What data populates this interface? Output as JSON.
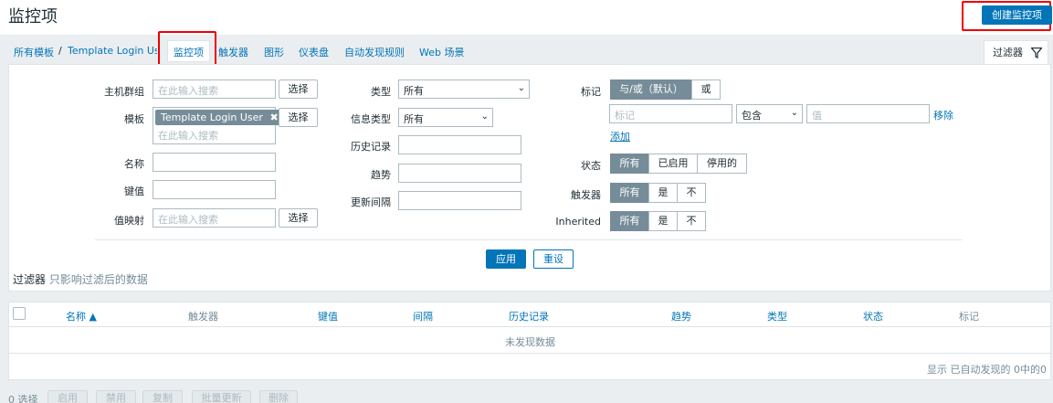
{
  "header": {
    "title": "监控项",
    "create_button": "创建监控项"
  },
  "breadcrumb": {
    "all_templates": "所有模板",
    "separator": "/",
    "template": "Template Login User"
  },
  "tabs": {
    "items": "监控项",
    "triggers": "触发器",
    "graphs": "图形",
    "dashboards": "仪表盘",
    "discovery": "自动发现规则",
    "web": "Web 场景"
  },
  "filter_tab": {
    "label": "过滤器",
    "icon": "filter-icon"
  },
  "filter": {
    "host_groups_label": "主机群组",
    "host_groups_placeholder": "在此输入搜索",
    "templates_label": "模板",
    "template_chip": "Template Login User",
    "templates_placeholder": "在此输入搜索",
    "name_label": "名称",
    "key_label": "键值",
    "valuemap_label": "值映射",
    "valuemap_placeholder": "在此输入搜索",
    "select_button": "选择",
    "type_label": "类型",
    "type_value": "所有",
    "info_type_label": "信息类型",
    "info_type_value": "所有",
    "history_label": "历史记录",
    "trends_label": "趋势",
    "update_interval_label": "更新间隔",
    "tags_label": "标记",
    "tags_andor": "与/或（默认）",
    "tags_or": "或",
    "tag_placeholder": "标记",
    "tag_operator": "包含",
    "tag_value_placeholder": "值",
    "tag_remove": "移除",
    "tag_add": "添加",
    "state_label": "状态",
    "state_options": [
      "所有",
      "已启用",
      "停用的"
    ],
    "triggers_label": "触发器",
    "triggers_options": [
      "所有",
      "是",
      "不"
    ],
    "inherited_label": "Inherited",
    "inherited_options": [
      "所有",
      "是",
      "不"
    ],
    "apply_button": "应用",
    "reset_button": "重设"
  },
  "filter_note": {
    "title": "过滤器",
    "subtitle": "只影响过滤后的数据"
  },
  "table": {
    "columns": [
      "名称 ▲",
      "触发器",
      "键值",
      "间隔",
      "历史记录",
      "趋势",
      "类型",
      "状态",
      "标记"
    ],
    "empty_text": "未发现数据",
    "footer": "显示 已自动发现的 0中的0"
  },
  "bulk": {
    "selected": "0 选择",
    "enable": "启用",
    "disable": "禁用",
    "copy": "复制",
    "mass_update": "批量更新",
    "delete": "删除"
  },
  "colors": {
    "primary": "#0275b8",
    "highlight_box": "#ef0000",
    "segment_on": "#768d99"
  }
}
